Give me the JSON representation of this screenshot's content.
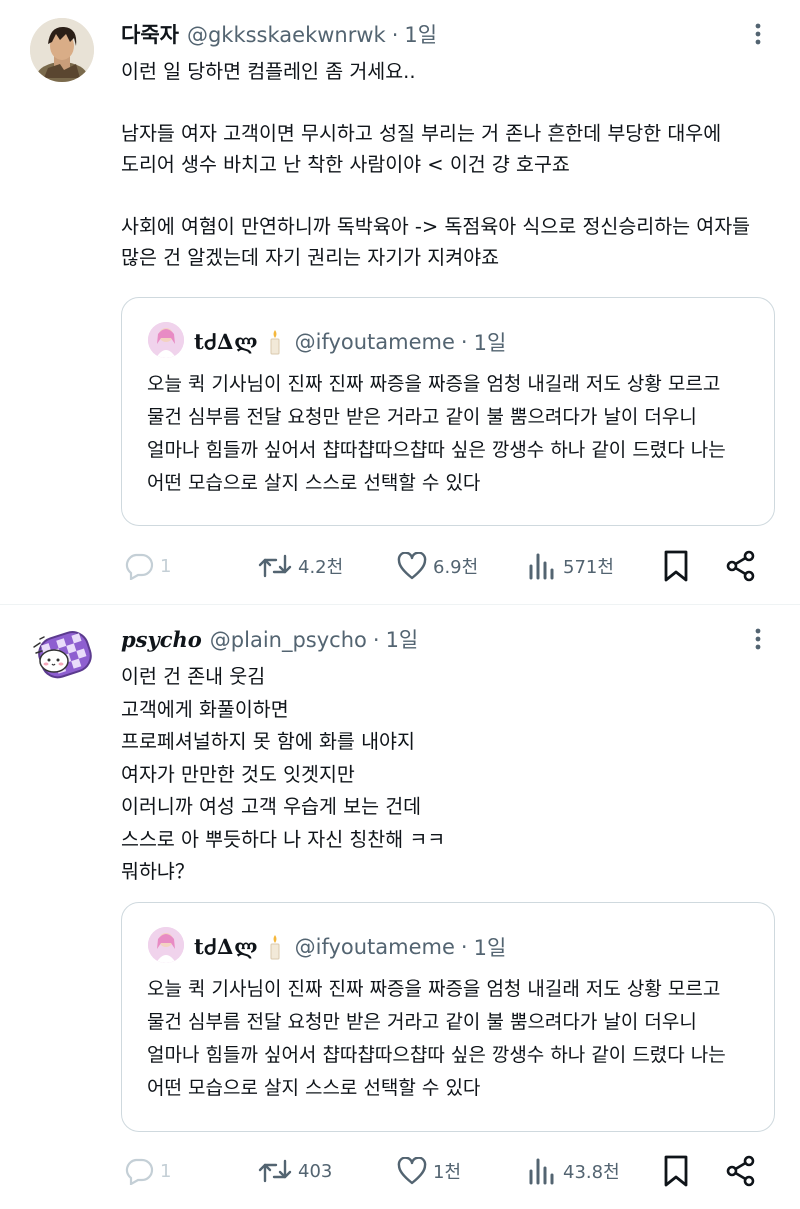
{
  "posts": [
    {
      "author_name": "다죽자",
      "handle": "@gkksskaekwnrwk",
      "separator": "·",
      "time": "1일",
      "text": "이런 일 당하면 컴플레인 좀 거세요..\n\n남자들 여자 고객이면 무시하고 성질 부리는 거 존나 흔한데 부당한 대우에\n도리어 생수 바치고 난 착한 사람이야 < 이건 걍 호구죠\n\n사회에 여혐이 만연하니까 독박육아 -> 독점육아 식으로 정신승리하는 여자들\n많은 건 알겠는데 자기 권리는 자기가 지켜야죠",
      "quote": {
        "author_name": "tᏧ∆ლ",
        "handle": "@ifyoutameme",
        "separator": "·",
        "time": "1일",
        "text": "오늘 퀵 기사님이 진짜 진짜 짜증을 짜증을 엄청 내길래 저도 상황 모르고\n물건 심부름 전달 요청만 받은 거라고 같이 불 뿜으려다가 날이 더우니\n얼마나 힘들까 싶어서 챱따챱따으챱따 싶은 깡생수 하나 같이 드렸다 나는\n어떤 모습으로 살지 스스로 선택할 수 있다"
      },
      "stats": {
        "replies": "1",
        "reposts": "4.2천",
        "likes": "6.9천",
        "views": "571천"
      }
    },
    {
      "author_name": "psycho",
      "handle": "@plain_psycho",
      "separator": "·",
      "time": "1일",
      "text": "이런 건 존내 웃김\n고객에게 화풀이하면\n프로페셔널하지 못 함에 화를 내야지\n여자가 만만한 것도 잇겟지만\n이러니까 여성 고객 우습게 보는 건데\n스스로 아 뿌듯하다 나 자신 칭찬해 ㅋㅋ\n뭐하냐？",
      "quote": {
        "author_name": "tᏧ∆ლ",
        "handle": "@ifyoutameme",
        "separator": "·",
        "time": "1일",
        "text": "오늘 퀵 기사님이 진짜 진짜 짜증을 짜증을 엄청 내길래 저도 상황 모르고\n물건 심부름 전달 요청만 받은 거라고 같이 불 뿜으려다가 날이 더우니\n얼마나 힘들까 싶어서 챱따챱따으챱따 싶은 깡생수 하나 같이 드렸다 나는\n어떤 모습으로 살지 스스로 선택할 수 있다"
      },
      "stats": {
        "replies": "1",
        "reposts": "403",
        "likes": "1천",
        "views": "43.8천"
      }
    }
  ],
  "icons": {
    "more": "more-vertical-icon",
    "reply": "reply-icon",
    "repost": "repost-icon",
    "like": "heart-icon",
    "views": "views-icon",
    "bookmark": "bookmark-icon",
    "share": "share-icon"
  },
  "colors": {
    "text": "#0f1419",
    "secondary": "#536471",
    "border": "#cfd9de",
    "reply_icon": "#c4cfd6"
  }
}
